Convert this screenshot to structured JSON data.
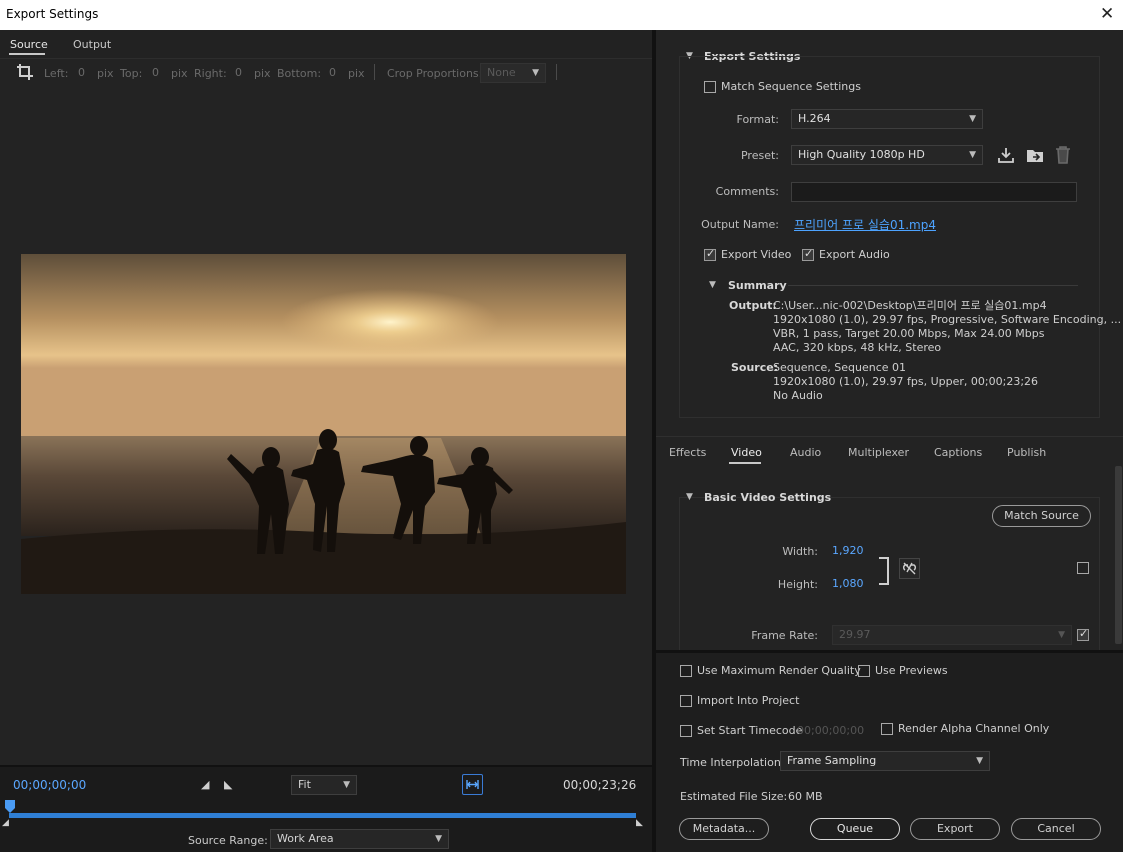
{
  "window": {
    "title": "Export Settings",
    "close": "✕"
  },
  "left": {
    "tabs": [
      {
        "label": "Source"
      },
      {
        "label": "Output"
      }
    ],
    "crop": {
      "left_label": "Left:",
      "left_value": "0",
      "left_unit": "pix",
      "top_label": "Top:",
      "top_value": "0",
      "top_unit": "pix",
      "right_label": "Right:",
      "right_value": "0",
      "right_unit": "pix",
      "bottom_label": "Bottom:",
      "bottom_value": "0",
      "bottom_unit": "pix",
      "proportions_label": "Crop Proportions:",
      "proportions_value": "None"
    },
    "timeline": {
      "current_time": "00;00;00;00",
      "end_time": "00;00;23;26",
      "zoom_value": "Fit",
      "source_range_label": "Source Range:",
      "source_range_value": "Work Area"
    }
  },
  "export_settings": {
    "section_title": "Export Settings",
    "match_sequence_label": "Match Sequence Settings",
    "format_label": "Format:",
    "format_value": "H.264",
    "preset_label": "Preset:",
    "preset_value": "High Quality 1080p HD",
    "comments_label": "Comments:",
    "comments_value": "",
    "output_name_label": "Output Name:",
    "output_name_value": "프리미어 프로 실습01.mp4",
    "export_video_label": "Export Video",
    "export_audio_label": "Export Audio",
    "summary": {
      "title": "Summary",
      "output_label": "Output:",
      "output_lines": [
        "C:\\User...nic-002\\Desktop\\프리미어 프로 실습01.mp4",
        "1920x1080 (1.0), 29.97 fps, Progressive, Software Encoding, ...",
        "VBR, 1 pass, Target 20.00 Mbps, Max 24.00 Mbps",
        "AAC, 320 kbps, 48 kHz, Stereo"
      ],
      "source_label": "Source:",
      "source_lines": [
        "Sequence, Sequence 01",
        "1920x1080 (1.0), 29.97 fps, Upper, 00;00;23;26",
        "No Audio"
      ]
    }
  },
  "settings_tabs": [
    {
      "label": "Effects"
    },
    {
      "label": "Video"
    },
    {
      "label": "Audio"
    },
    {
      "label": "Multiplexer"
    },
    {
      "label": "Captions"
    },
    {
      "label": "Publish"
    }
  ],
  "basic_video": {
    "title": "Basic Video Settings",
    "match_source": "Match Source",
    "width_label": "Width:",
    "width_value": "1,920",
    "height_label": "Height:",
    "height_value": "1,080",
    "frame_rate_label": "Frame Rate:",
    "frame_rate_value": "29.97"
  },
  "bottom": {
    "max_render_label": "Use Maximum Render Quality",
    "use_previews_label": "Use Previews",
    "import_label": "Import Into Project",
    "set_start_tc_label": "Set Start Timecode",
    "start_tc_value": "00;00;00;00",
    "render_alpha_label": "Render Alpha Channel Only",
    "time_interp_label": "Time Interpolation:",
    "time_interp_value": "Frame Sampling",
    "file_size_label": "Estimated File Size:",
    "file_size_value": "60 MB",
    "metadata_btn": "Metadata...",
    "queue_btn": "Queue",
    "export_btn": "Export",
    "cancel_btn": "Cancel"
  }
}
